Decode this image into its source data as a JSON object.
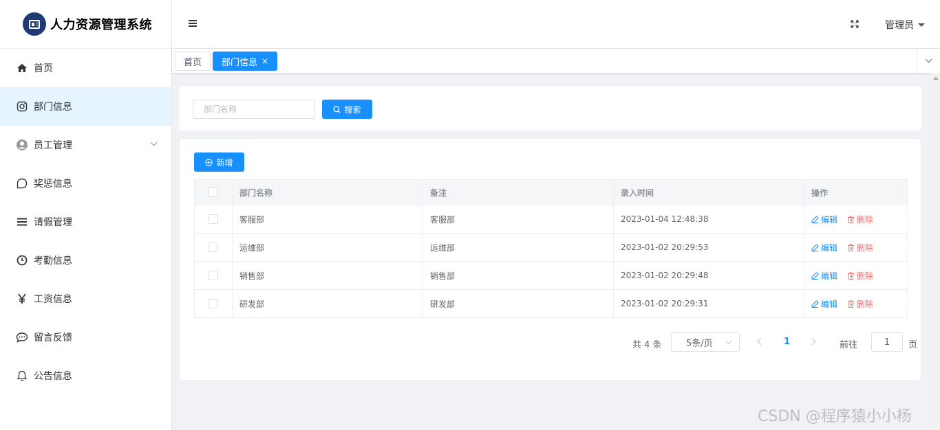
{
  "app": {
    "title": "人力资源管理系统"
  },
  "sidebar": {
    "items": [
      {
        "label": "首页",
        "icon": "home-icon"
      },
      {
        "label": "部门信息",
        "icon": "instagram-icon",
        "active": true
      },
      {
        "label": "员工管理",
        "icon": "user-circle-icon",
        "expandable": true
      },
      {
        "label": "奖惩信息",
        "icon": "chat-bubble-icon"
      },
      {
        "label": "请假管理",
        "icon": "list-icon"
      },
      {
        "label": "考勤信息",
        "icon": "clock-icon"
      },
      {
        "label": "工资信息",
        "icon": "yen-icon"
      },
      {
        "label": "留言反馈",
        "icon": "comment-dots-icon"
      },
      {
        "label": "公告信息",
        "icon": "bell-icon"
      }
    ]
  },
  "header": {
    "user": "管理员"
  },
  "tabs": [
    {
      "label": "首页"
    },
    {
      "label": "部门信息",
      "active": true,
      "close": "×"
    }
  ],
  "search": {
    "placeholder": "部门名称",
    "button": "搜索"
  },
  "toolbar": {
    "add_label": "新增"
  },
  "table": {
    "columns": [
      "部门名称",
      "备注",
      "录入时间",
      "操作"
    ],
    "rows": [
      {
        "name": "客服部",
        "remark": "客服部",
        "time": "2023-01-04 12:48:38"
      },
      {
        "name": "运维部",
        "remark": "运维部",
        "time": "2023-01-02 20:29:53"
      },
      {
        "name": "销售部",
        "remark": "销售部",
        "time": "2023-01-02 20:29:48"
      },
      {
        "name": "研发部",
        "remark": "研发部",
        "time": "2023-01-02 20:29:31"
      }
    ],
    "actions": {
      "edit": "编辑",
      "delete": "删除"
    }
  },
  "pagination": {
    "total": "共 4 条",
    "page_size": "5条/页",
    "current_page": "1",
    "goto_label": "前往",
    "goto_value": "1",
    "page_suffix": "页"
  },
  "watermark": "CSDN @程序猿小小杨",
  "colors": {
    "primary": "#1890ff",
    "danger": "#f56c6c",
    "active_bg": "#e6f4ff",
    "logo": "#1f3a72"
  }
}
